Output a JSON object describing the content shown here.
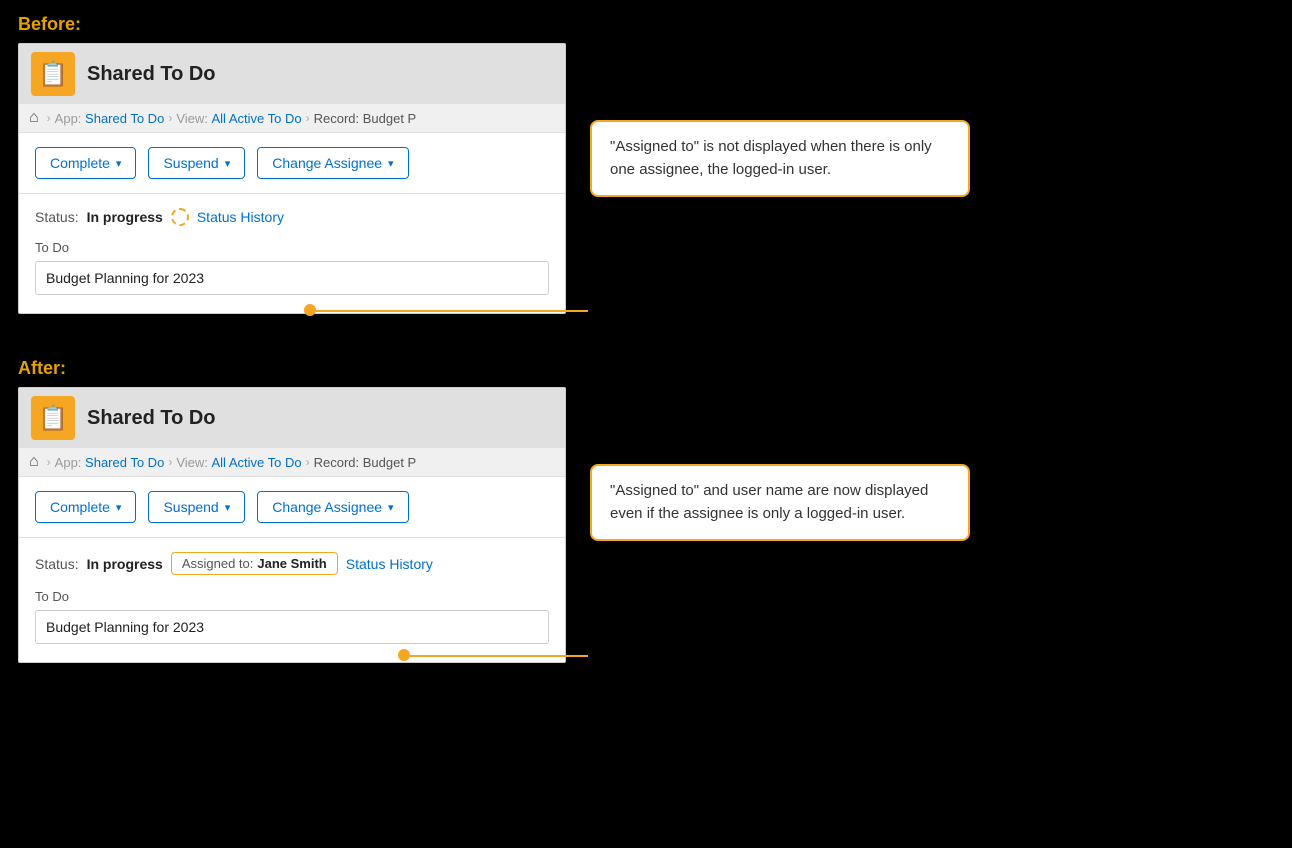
{
  "before_label": "Before:",
  "after_label": "After:",
  "app": {
    "title": "Shared To Do",
    "icon": "📋",
    "breadcrumb": {
      "home_icon": "⌂",
      "app_label": "App:",
      "app_link": "Shared To Do",
      "view_label": "View:",
      "view_link": "All Active To Do",
      "record_label": "Record: Budget P"
    },
    "actions": {
      "complete": "Complete",
      "suspend": "Suspend",
      "change_assignee": "Change Assignee"
    },
    "before": {
      "status_label": "Status:",
      "status_value": "In progress",
      "status_history": "Status History",
      "field_label": "To Do",
      "field_value": "Budget Planning for 2023"
    },
    "after": {
      "status_label": "Status:",
      "status_value": "In progress",
      "assigned_to_label": "Assigned to:",
      "assigned_to_name": "Jane Smith",
      "status_history": "Status History",
      "field_label": "To Do",
      "field_value": "Budget Planning for 2023"
    }
  },
  "annotations": {
    "before": "\"Assigned to\" is not displayed when there is only one assignee, the logged-in user.",
    "after": "\"Assigned to\" and user name are now displayed even if the assignee is only a logged-in user."
  },
  "colors": {
    "accent": "#f5a623",
    "link": "#0070d2",
    "border": "#ccc"
  }
}
